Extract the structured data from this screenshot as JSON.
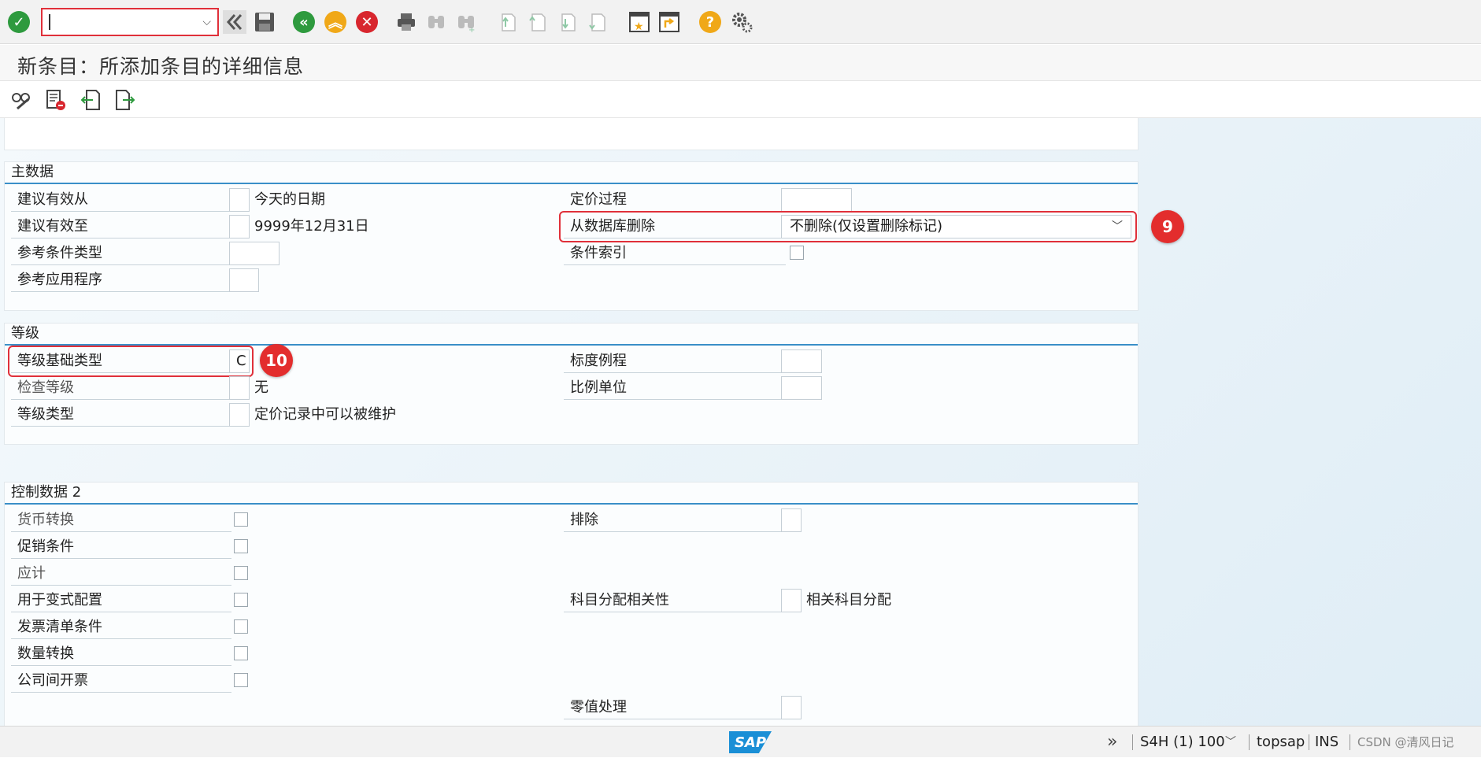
{
  "toolbar": {
    "command_field_value": "",
    "icons": [
      "enter-icon",
      "command-field",
      "back-nav-icon",
      "save-icon",
      "back-icon",
      "exit-icon",
      "cancel-icon",
      "print-icon",
      "find-icon",
      "find-next-icon",
      "first-page-icon",
      "previous-page-icon",
      "next-page-icon",
      "last-page-icon",
      "create-session-icon",
      "shortcut-icon",
      "help-icon",
      "settings-icon"
    ]
  },
  "title": "新条目：所添加条目的详细信息",
  "app_toolbar": {
    "icons": [
      "display-change-icon",
      "delete-icon",
      "previous-entry-icon",
      "next-entry-icon"
    ]
  },
  "master_data": {
    "title": "主数据",
    "fields": {
      "valid_from_label": "建议有效从",
      "valid_from_value": "今天的日期",
      "valid_to_label": "建议有效至",
      "valid_to_value": "9999年12月31日",
      "ref_cond_type_label": "参考条件类型",
      "ref_application_label": "参考应用程序",
      "pricing_proc_label": "定价过程",
      "delete_from_db_label": "从数据库删除",
      "delete_from_db_value": "不删除(仅设置删除标记)",
      "cond_index_label": "条件索引"
    },
    "badge": "9"
  },
  "scales": {
    "title": "等级",
    "fields": {
      "scale_base_type_label": "等级基础类型",
      "scale_base_type_value": "C",
      "check_scale_label": "检查等级",
      "check_scale_value": "无",
      "scale_type_label": "等级类型",
      "scale_type_value": "定价记录中可以被维护",
      "scale_formula_label": "标度例程",
      "scale_unit_label": "比例单位"
    },
    "badge": "10"
  },
  "control_data": {
    "title": "控制数据 2",
    "fields": {
      "currency_conv_label": "货币转换",
      "promo_cond_label": "促销条件",
      "accrual_label": "应计",
      "variant_config_label": "用于变式配置",
      "invoice_list_label": "发票清单条件",
      "qty_conv_label": "数量转换",
      "intercompany_label": "公司间开票",
      "exclusion_label": "排除",
      "acct_assign_label": "科目分配相关性",
      "acct_assign_value": "相关科目分配",
      "zero_value_label": "零值处理"
    }
  },
  "status_bar": {
    "logo": "SAP",
    "system": "S4H (1) 100",
    "server": "topsap",
    "mode": "INS",
    "watermark": "CSDN @清风日记"
  }
}
